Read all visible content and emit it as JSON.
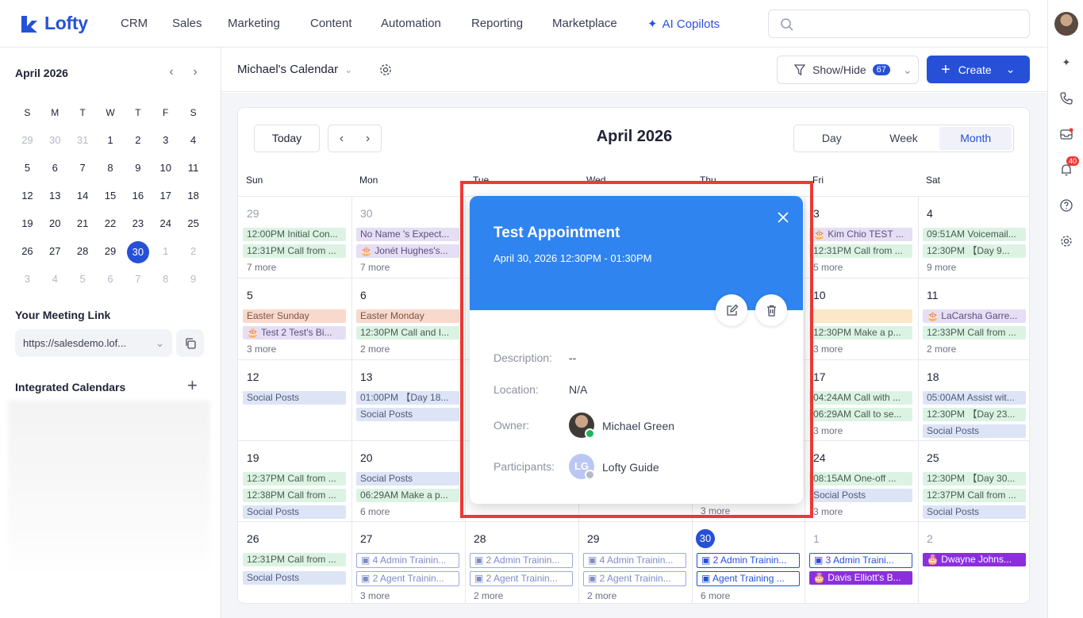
{
  "nav": {
    "logo": "Lofty",
    "items": [
      "CRM",
      "Sales",
      "Marketing",
      "Content",
      "Automation",
      "Reporting",
      "Marketplace"
    ],
    "ai_label": "AI Copilots",
    "search_placeholder": ""
  },
  "rail": {
    "notification_count": "40"
  },
  "mini_calendar": {
    "title": "April 2026",
    "weekdays": [
      "S",
      "M",
      "T",
      "W",
      "T",
      "F",
      "S"
    ],
    "weeks": [
      [
        "29",
        "30",
        "31",
        "1",
        "2",
        "3",
        "4"
      ],
      [
        "5",
        "6",
        "7",
        "8",
        "9",
        "10",
        "11"
      ],
      [
        "12",
        "13",
        "14",
        "15",
        "16",
        "17",
        "18"
      ],
      [
        "19",
        "20",
        "21",
        "22",
        "23",
        "24",
        "25"
      ],
      [
        "26",
        "27",
        "28",
        "29",
        "30",
        "1",
        "2"
      ],
      [
        "3",
        "4",
        "5",
        "6",
        "7",
        "8",
        "9"
      ]
    ],
    "selected": "30"
  },
  "meeting": {
    "title": "Your Meeting Link",
    "link": "https://salesdemo.lof..."
  },
  "integrated": {
    "title": "Integrated Calendars"
  },
  "toolbar": {
    "calendar_name": "Michael's Calendar",
    "showhide_label": "Show/Hide",
    "showhide_count": "67",
    "create_label": "Create"
  },
  "calendar": {
    "today_label": "Today",
    "title": "April 2026",
    "views": [
      "Day",
      "Week",
      "Month"
    ],
    "active_view": "Month",
    "weekdays": [
      "Sun",
      "Mon",
      "Tue",
      "Wed",
      "Thu",
      "Fri",
      "Sat"
    ],
    "cells": {
      "r0": [
        {
          "day": "29",
          "events": [
            [
              "green",
              "12:00PM Initial Con..."
            ],
            [
              "green",
              "12:31PM Call from ..."
            ]
          ],
          "more": "7 more"
        },
        {
          "day": "30",
          "events": [
            [
              "purple",
              "No Name 's Expect..."
            ],
            [
              "purple",
              "🎂 Jonét Hughes's..."
            ]
          ],
          "more": "7 more"
        },
        null,
        null,
        null,
        {
          "day": "3",
          "events": [
            [
              "purple",
              "🎂 Kim Chio TEST ..."
            ],
            [
              "green",
              "12:31PM Call from ..."
            ]
          ],
          "more": "5 more"
        },
        {
          "day": "4",
          "events": [
            [
              "green",
              "09:51AM Voicemail..."
            ],
            [
              "green",
              "12:30PM 【Day 9..."
            ]
          ],
          "more": "9 more"
        }
      ],
      "r1": [
        {
          "day": "5",
          "events": [
            [
              "orange",
              "Easter Sunday"
            ],
            [
              "purple",
              "🎂 Test 2 Test's Bi..."
            ]
          ],
          "more": "3 more"
        },
        {
          "day": "6",
          "events": [
            [
              "orange",
              "Easter Monday"
            ],
            [
              "green",
              "12:30PM Call and I..."
            ]
          ],
          "more": "2 more"
        },
        null,
        null,
        null,
        {
          "day": "10",
          "events": [
            [
              "yellow",
              ""
            ],
            [
              "green",
              "12:30PM Make a p..."
            ]
          ],
          "more": "3 more"
        },
        {
          "day": "11",
          "events": [
            [
              "purple",
              "🎂 LaCarsha Garre..."
            ],
            [
              "green",
              "12:33PM Call from ..."
            ]
          ],
          "more": "2 more"
        }
      ],
      "r2": [
        {
          "day": "12",
          "events": [
            [
              "blue",
              "Social Posts"
            ]
          ],
          "more": ""
        },
        {
          "day": "13",
          "events": [
            [
              "blue",
              "01:00PM 【Day 18..."
            ],
            [
              "blue",
              "Social Posts"
            ]
          ],
          "more": ""
        },
        null,
        null,
        null,
        {
          "day": "17",
          "events": [
            [
              "green",
              "04:24AM Call with ..."
            ],
            [
              "green",
              "06:29AM Call to se..."
            ]
          ],
          "more": "3 more"
        },
        {
          "day": "18",
          "events": [
            [
              "blue",
              "05:00AM Assist wit..."
            ],
            [
              "green",
              "12:30PM 【Day 23..."
            ],
            [
              "blue",
              "Social Posts"
            ]
          ],
          "more": ""
        }
      ],
      "r3": [
        {
          "day": "19",
          "events": [
            [
              "green",
              "12:37PM Call from ..."
            ],
            [
              "green",
              "12:38PM Call from ..."
            ],
            [
              "blue",
              "Social Posts"
            ]
          ],
          "more": ""
        },
        {
          "day": "20",
          "events": [
            [
              "blue",
              "Social Posts"
            ],
            [
              "green",
              "06:29AM Make a p..."
            ]
          ],
          "more": "6 more"
        },
        null,
        null,
        {
          "day": "",
          "events": [],
          "more": "3 more"
        },
        {
          "day": "24",
          "events": [
            [
              "green",
              "08:15AM One-off ..."
            ],
            [
              "blue",
              "Social Posts"
            ]
          ],
          "more": "3 more"
        },
        {
          "day": "25",
          "events": [
            [
              "green",
              "12:30PM 【Day 30..."
            ],
            [
              "green",
              "12:37PM Call from ..."
            ],
            [
              "blue",
              "Social Posts"
            ]
          ],
          "more": ""
        }
      ],
      "r4": [
        {
          "day": "26",
          "events": [
            [
              "green",
              "12:31PM Call from ..."
            ],
            [
              "blue",
              "Social Posts"
            ]
          ],
          "more": ""
        },
        {
          "day": "27",
          "events": [
            [
              "outline faded",
              "4 Admin Trainin..."
            ],
            [
              "outline faded",
              "2 Agent Trainin..."
            ]
          ],
          "more": "3 more"
        },
        {
          "day": "28",
          "events": [
            [
              "outline faded",
              "2 Admin Trainin..."
            ],
            [
              "outline faded",
              "2 Agent Trainin..."
            ]
          ],
          "more": "2 more"
        },
        {
          "day": "29",
          "events": [
            [
              "outline faded",
              "4 Admin Trainin..."
            ],
            [
              "outline faded",
              "2 Agent Trainin..."
            ]
          ],
          "more": "2 more"
        },
        {
          "day": "30",
          "events": [
            [
              "outline",
              "2 Admin Trainin..."
            ],
            [
              "outline",
              "Agent Training ..."
            ]
          ],
          "more": "6 more"
        },
        {
          "day": "1",
          "events": [
            [
              "outline",
              "3 Admin Traini..."
            ],
            [
              "solid-purple",
              "🎂 Davis Elliott's B..."
            ]
          ],
          "more": ""
        },
        {
          "day": "2",
          "events": [
            [
              "solid-purple",
              "🎂 Dwayne Johns..."
            ]
          ],
          "more": ""
        }
      ]
    }
  },
  "popup": {
    "title": "Test Appointment",
    "time": "April 30, 2026 12:30PM - 01:30PM",
    "description_label": "Description:",
    "description_value": "--",
    "location_label": "Location:",
    "location_value": "N/A",
    "owner_label": "Owner:",
    "owner_value": "Michael Green",
    "participants_label": "Participants:",
    "participants_value": "Lofty Guide",
    "participant_initials": "LG"
  },
  "colors": {
    "brand": "#2650d8",
    "popup_header": "#2f84f0",
    "highlight": "#ee3a35"
  }
}
